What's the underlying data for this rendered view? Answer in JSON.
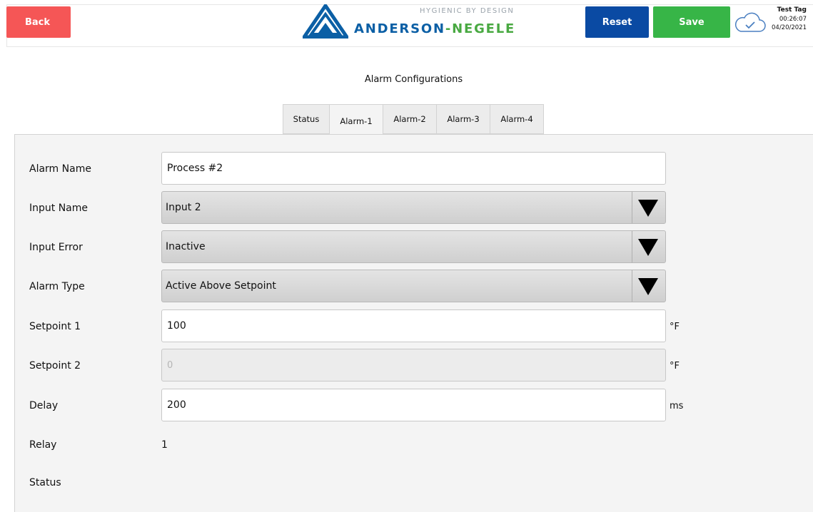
{
  "header": {
    "back_label": "Back",
    "reset_label": "Reset",
    "save_label": "Save",
    "logo": {
      "tagline": "HYGIENIC BY DESIGN",
      "name_part1": "ANDERSON",
      "name_sep": "-",
      "name_part2": "NEGELE"
    },
    "tag": {
      "name": "Test Tag",
      "time": "00:26:07",
      "date": "04/20/2021"
    },
    "cloud_icon": "cloud-check-icon"
  },
  "page": {
    "title": "Alarm Configurations"
  },
  "tabs": [
    {
      "label": "Status",
      "active": false
    },
    {
      "label": "Alarm-1",
      "active": true
    },
    {
      "label": "Alarm-2",
      "active": false
    },
    {
      "label": "Alarm-3",
      "active": false
    },
    {
      "label": "Alarm-4",
      "active": false
    }
  ],
  "form": {
    "alarm_name": {
      "label": "Alarm Name",
      "value": "Process #2"
    },
    "input_name": {
      "label": "Input Name",
      "value": "Input 2"
    },
    "input_error": {
      "label": "Input Error",
      "value": "Inactive"
    },
    "alarm_type": {
      "label": "Alarm Type",
      "value": "Active Above Setpoint"
    },
    "setpoint1": {
      "label": "Setpoint 1",
      "value": "100",
      "unit": "°F"
    },
    "setpoint2": {
      "label": "Setpoint 2",
      "placeholder": "0",
      "unit": "°F"
    },
    "delay": {
      "label": "Delay",
      "value": "200",
      "unit": "ms"
    },
    "relay": {
      "label": "Relay",
      "value": "1"
    },
    "status": {
      "label": "Status"
    }
  },
  "colors": {
    "back": "#f55656",
    "reset": "#0a4aa3",
    "save": "#37b547",
    "brand_blue": "#0b5fa5",
    "brand_green": "#49a942"
  }
}
